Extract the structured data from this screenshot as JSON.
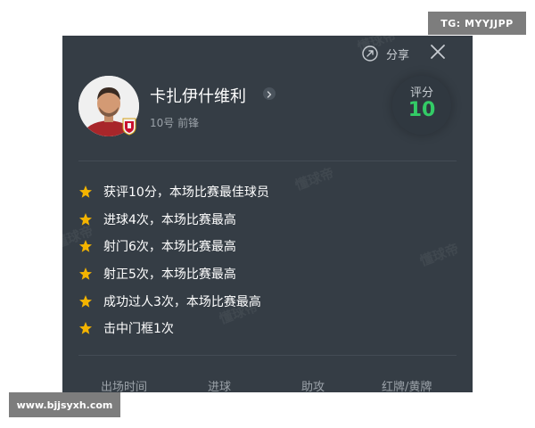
{
  "overlay": {
    "tg_badge": "TG: MYYJJPP",
    "site_badge": "www.bjjsyxh.com"
  },
  "card": {
    "share_label": "分享",
    "player": {
      "name": "卡扎伊什维利",
      "meta": "10号 前锋"
    },
    "score": {
      "label": "评分",
      "value": "10",
      "color": "#33cc66"
    },
    "highlights": [
      {
        "icon": "star-icon",
        "text": "获评10分，本场比赛最佳球员"
      },
      {
        "icon": "star-icon",
        "text": "进球4次，本场比赛最高"
      },
      {
        "icon": "star-icon",
        "text": "射门6次，本场比赛最高"
      },
      {
        "icon": "star-icon",
        "text": "射正5次，本场比赛最高"
      },
      {
        "icon": "star-icon",
        "text": "成功过人3次，本场比赛最高"
      },
      {
        "icon": "star-icon",
        "text": "击中门框1次"
      }
    ],
    "stat_headers": [
      "出场时间",
      "进球",
      "助攻",
      "红牌/黄牌"
    ],
    "watermark_text": "懂球帝"
  },
  "colors": {
    "card_bg": "#353d45",
    "accent_green": "#33cc66",
    "star_gold": "#f4b400"
  }
}
